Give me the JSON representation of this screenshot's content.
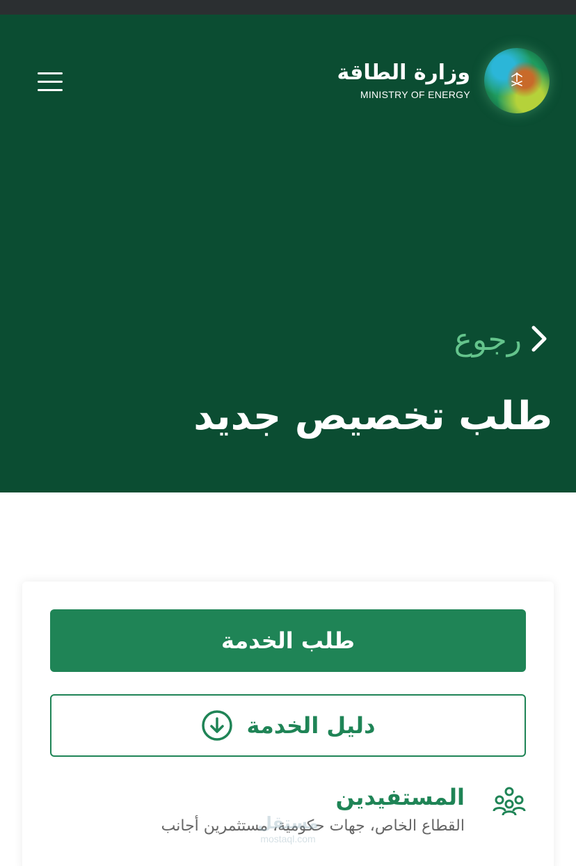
{
  "header": {
    "logo_ar": "وزارة الطاقة",
    "logo_en": "MINISTRY OF ENERGY",
    "menu_icon": "hamburger-menu-icon"
  },
  "hero": {
    "back_label": "رجوع",
    "back_icon": "chevron-right-icon",
    "title": "طلب تخصيص جديد"
  },
  "card": {
    "request_button_label": "طلب الخدمة",
    "guide_button_label": "دليل الخدمة",
    "guide_icon": "download-circle-icon",
    "beneficiaries": {
      "title": "المستفيدين",
      "description": "القطاع الخاص، جهات حكومية، مستثمرين أجانب",
      "icon": "users-group-icon"
    }
  },
  "watermark": {
    "ar": "مستقل",
    "en": "mostaql.com"
  },
  "colors": {
    "hero_bg": "#0b4d32",
    "accent": "#1f8456",
    "back_link": "#64c48c",
    "status_strip": "#2b2f31"
  }
}
